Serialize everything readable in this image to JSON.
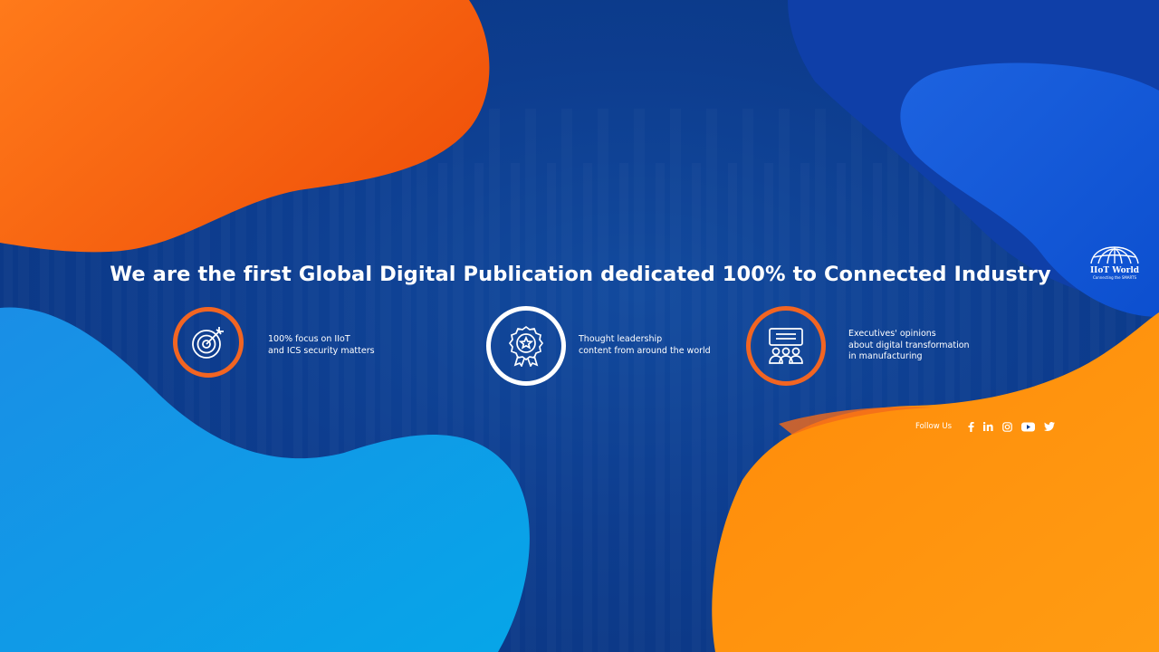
{
  "headline": "We are the first Global Digital Publication dedicated 100% to Connected Industry",
  "features": [
    {
      "icon": "target-icon",
      "lines": [
        "100% focus on IIoT",
        "and ICS security matters"
      ]
    },
    {
      "icon": "award-badge-icon",
      "lines": [
        "Thought leadership",
        "content from around the world"
      ]
    },
    {
      "icon": "presentation-audience-icon",
      "lines": [
        "Executives' opinions",
        "about digital transformation",
        "in manufacturing"
      ]
    }
  ],
  "logo": {
    "title": "IIoT World",
    "tagline": "Connecting the SMARTS"
  },
  "follow": {
    "label": "Follow Us",
    "icons": [
      "facebook-icon",
      "linkedin-icon",
      "instagram-icon",
      "youtube-icon",
      "twitter-icon"
    ]
  },
  "colors": {
    "background": "#0d3d8f",
    "orange_accent": "#f26522",
    "light_orange": "#ff9a10",
    "light_blue": "#0aa0e4",
    "bright_blue": "#1466e0",
    "text": "#ffffff"
  }
}
